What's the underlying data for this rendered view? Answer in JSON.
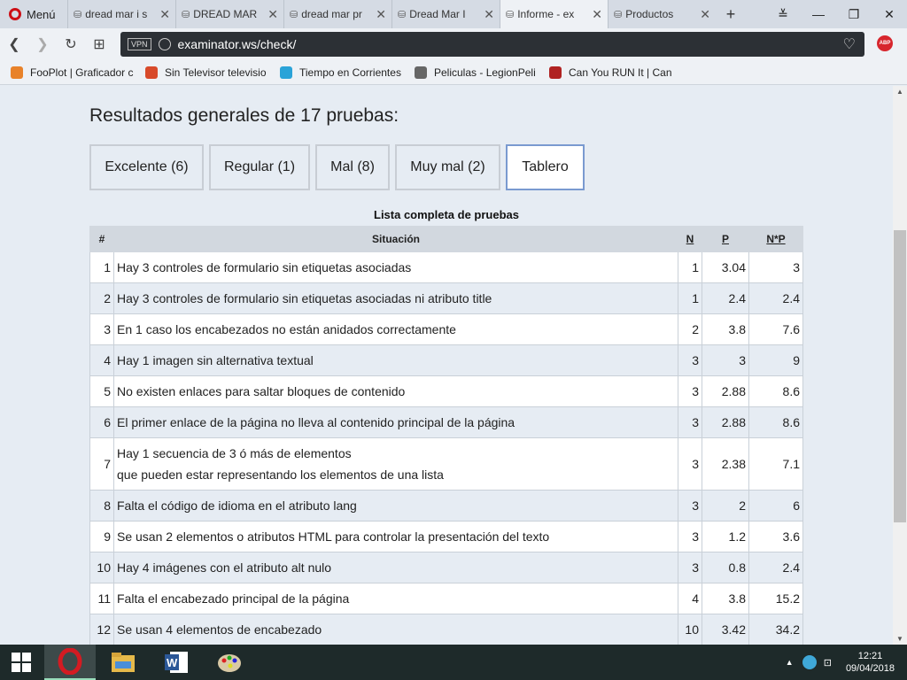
{
  "browser": {
    "menu_label": "Menú",
    "tabs": [
      {
        "label": "dread mar i s",
        "active": false
      },
      {
        "label": "DREAD MAR",
        "active": false
      },
      {
        "label": "dread mar pr",
        "active": false
      },
      {
        "label": "Dread Mar I",
        "active": false
      },
      {
        "label": "Informe - ex",
        "active": true
      },
      {
        "label": "Productos",
        "active": false
      }
    ],
    "url": "examinator.ws/check/",
    "vpn_label": "VPN",
    "abp_label": "ABP",
    "bookmarks": [
      {
        "label": "FooPlot | Graficador c",
        "color": "#e8822a"
      },
      {
        "label": "Sin Televisor televisio",
        "color": "#d84a2a"
      },
      {
        "label": "Tiempo en Corrientes",
        "color": "#2aa3d8"
      },
      {
        "label": "Peliculas - LegionPeli",
        "color": "#666666"
      },
      {
        "label": "Can You RUN It | Can",
        "color": "#b02222"
      }
    ]
  },
  "page": {
    "title": "Resultados generales de 17 pruebas:",
    "filters": [
      {
        "label": "Excelente (6)",
        "active": false
      },
      {
        "label": "Regular (1)",
        "active": false
      },
      {
        "label": "Mal (8)",
        "active": false
      },
      {
        "label": "Muy mal (2)",
        "active": false
      },
      {
        "label": "Tablero",
        "active": true
      }
    ],
    "table_caption": "Lista completa de pruebas",
    "columns": {
      "num": "#",
      "situation": "Situación",
      "n": "N",
      "p": "P",
      "np": "N*P"
    },
    "rows": [
      {
        "num": "1",
        "situation": "Hay 3 controles de formulario sin etiquetas asociadas",
        "n": "1",
        "p": "3.04",
        "np": "3"
      },
      {
        "num": "2",
        "situation": "Hay 3 controles de formulario sin etiquetas asociadas ni atributo title",
        "n": "1",
        "p": "2.4",
        "np": "2.4"
      },
      {
        "num": "3",
        "situation": "En 1 caso los encabezados no están anidados correctamente",
        "n": "2",
        "p": "3.8",
        "np": "7.6"
      },
      {
        "num": "4",
        "situation": "Hay 1 imagen sin alternativa textual",
        "n": "3",
        "p": "3",
        "np": "9"
      },
      {
        "num": "5",
        "situation": "No existen enlaces para saltar bloques de contenido",
        "n": "3",
        "p": "2.88",
        "np": "8.6"
      },
      {
        "num": "6",
        "situation": "El primer enlace de la página no lleva al contenido principal de la página",
        "n": "3",
        "p": "2.88",
        "np": "8.6"
      },
      {
        "num": "7",
        "situation": "Hay 1 secuencia de 3 ó más de elementos",
        "situation2": "que pueden estar representando los elementos de una lista",
        "n": "3",
        "p": "2.38",
        "np": "7.1"
      },
      {
        "num": "8",
        "situation": "Falta el código de idioma en el atributo lang",
        "n": "3",
        "p": "2",
        "np": "6"
      },
      {
        "num": "9",
        "situation": "Se usan 2 elementos o atributos HTML para controlar la presentación del texto",
        "n": "3",
        "p": "1.2",
        "np": "3.6"
      },
      {
        "num": "10",
        "situation": "Hay 4 imágenes con el atributo alt nulo",
        "n": "3",
        "p": "0.8",
        "np": "2.4"
      },
      {
        "num": "11",
        "situation": "Falta el encabezado principal de la página",
        "n": "4",
        "p": "3.8",
        "np": "15.2"
      },
      {
        "num": "12",
        "situation": "Se usan 4 elementos de encabezado",
        "n": "10",
        "p": "3.42",
        "np": "34.2"
      }
    ]
  },
  "taskbar": {
    "time": "12:21",
    "date": "09/04/2018",
    "apps": [
      "opera-icon",
      "file-explorer-icon",
      "word-icon",
      "paint-icon"
    ]
  }
}
